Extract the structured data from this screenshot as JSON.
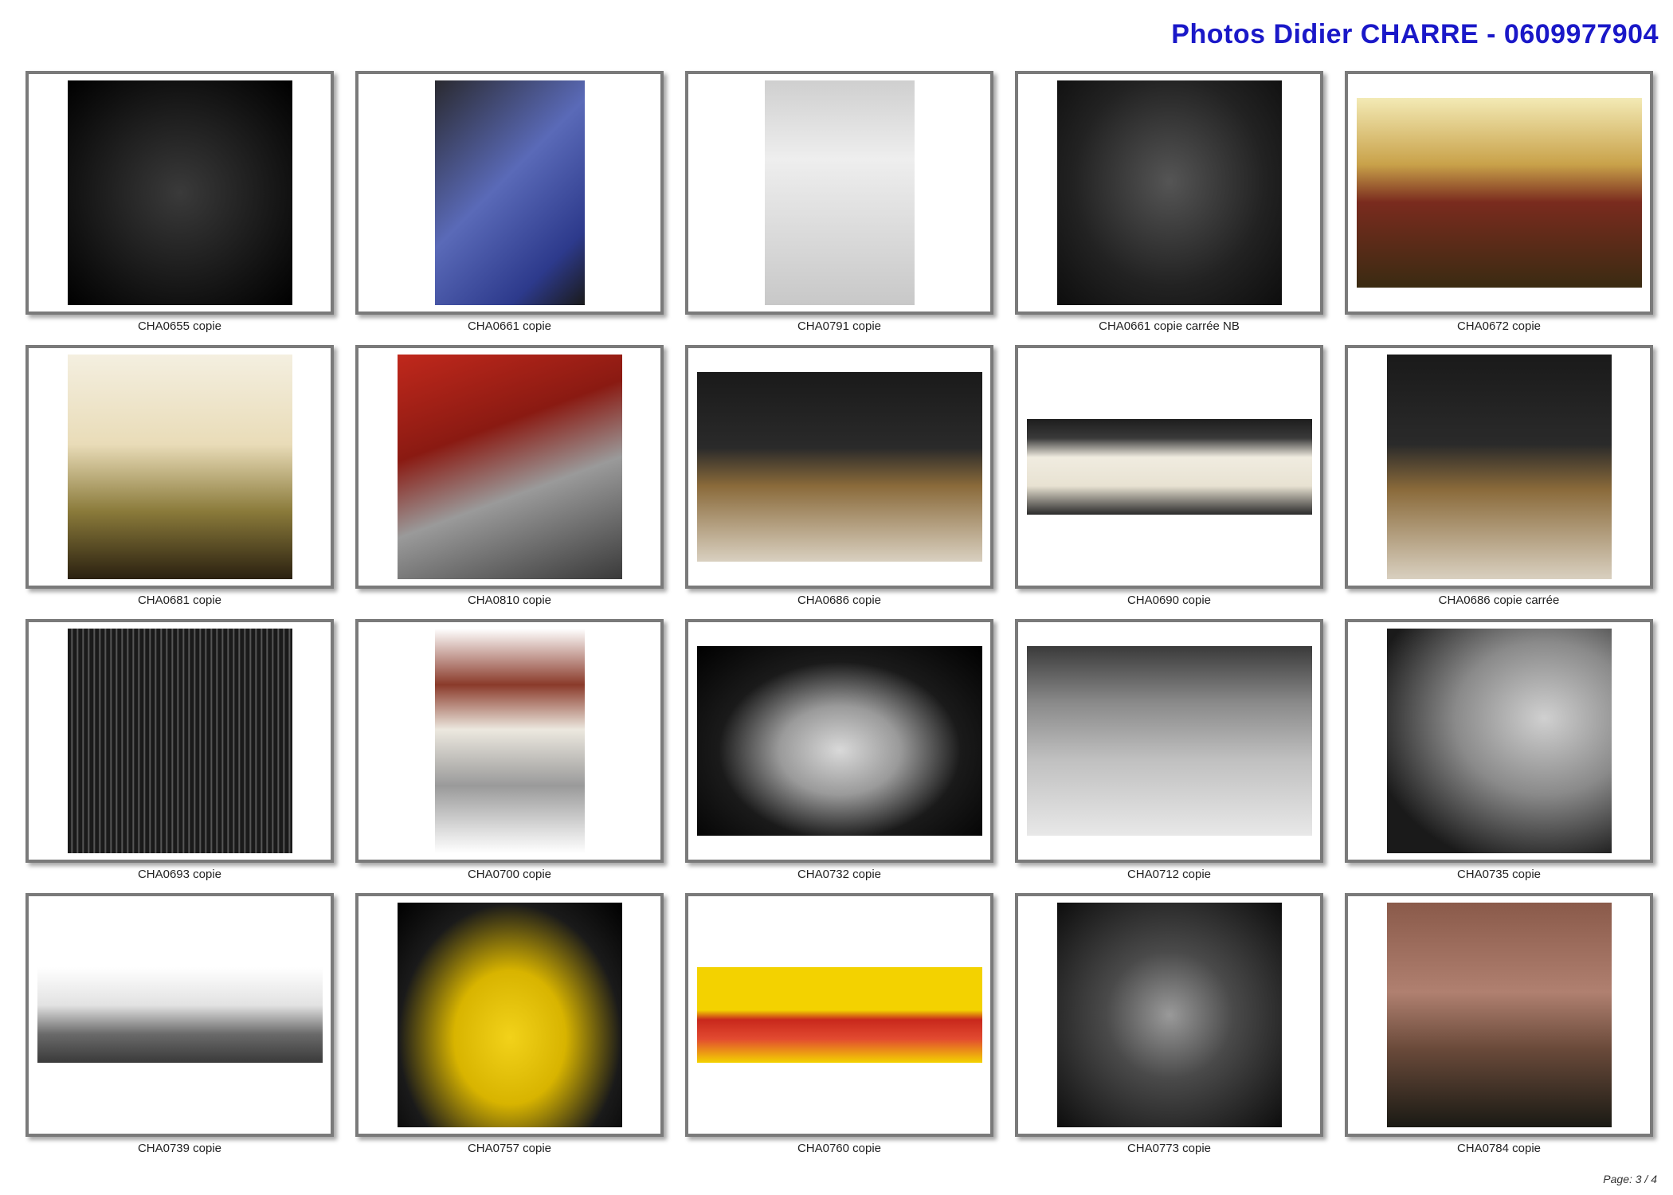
{
  "header": {
    "title": "Photos Didier CHARRE - 0609977904"
  },
  "footer": {
    "page_label": "Page: 3 / 4"
  },
  "colors": {
    "title": "#1a18c8",
    "frame_border": "#7a7a7a"
  },
  "thumbnails": [
    {
      "caption": "CHA0655 copie",
      "shape": "square",
      "style": "bg-dark"
    },
    {
      "caption": "CHA0661 copie",
      "shape": "portrait",
      "style": "bg-darkblue"
    },
    {
      "caption": "CHA0791 copie",
      "shape": "portrait",
      "style": "bg-silver"
    },
    {
      "caption": "CHA0661 copie carrée NB",
      "shape": "square",
      "style": "bg-bw"
    },
    {
      "caption": "CHA0672 copie",
      "shape": "wide",
      "style": "bg-engine-yellow"
    },
    {
      "caption": "CHA0681 copie",
      "shape": "square",
      "style": "bg-cream-grille"
    },
    {
      "caption": "CHA0810 copie",
      "shape": "square",
      "style": "bg-red-moto"
    },
    {
      "caption": "CHA0686 copie",
      "shape": "wide",
      "style": "bg-horch"
    },
    {
      "caption": "CHA0690 copie",
      "shape": "landscape",
      "style": "bg-vette"
    },
    {
      "caption": "CHA0686 copie carrée",
      "shape": "square",
      "style": "bg-horch"
    },
    {
      "caption": "CHA0693 copie",
      "shape": "square",
      "style": "bg-ferrari"
    },
    {
      "caption": "CHA0700 copie",
      "shape": "portrait",
      "style": "bg-moto-white"
    },
    {
      "caption": "CHA0732 copie",
      "shape": "wide",
      "style": "bg-merc-dark"
    },
    {
      "caption": "CHA0712 copie",
      "shape": "wide",
      "style": "bg-merc-grey"
    },
    {
      "caption": "CHA0735 copie",
      "shape": "square",
      "style": "bg-merc-close"
    },
    {
      "caption": "CHA0739 copie",
      "shape": "landscape",
      "style": "bg-911"
    },
    {
      "caption": "CHA0757 copie",
      "shape": "square",
      "style": "bg-yellow-rs"
    },
    {
      "caption": "CHA0760 copie",
      "shape": "landscape",
      "style": "bg-carrera"
    },
    {
      "caption": "CHA0773 copie",
      "shape": "square",
      "style": "bg-vincent"
    },
    {
      "caption": "CHA0784 copie",
      "shape": "square",
      "style": "bg-bugatti"
    }
  ]
}
